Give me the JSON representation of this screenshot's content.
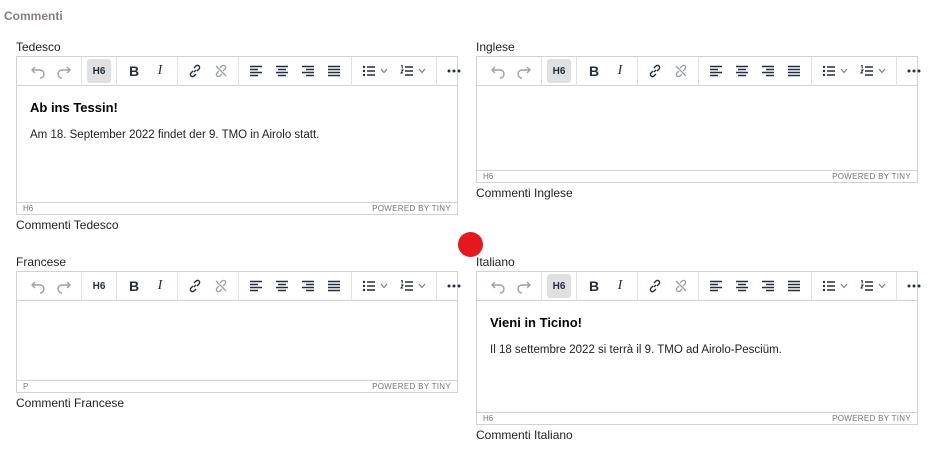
{
  "section_title": "Commenti",
  "toolbar": {
    "undo": "undo-icon",
    "redo": "redo-icon",
    "block_format": "H6",
    "bold": "B",
    "italic": "I"
  },
  "editors": {
    "de": {
      "label": "Tedesco",
      "heading": "Ab ins Tessin!",
      "paragraph": "Am 18. September 2022 findet der 9. TMO in Airolo statt.",
      "status_path": "H6",
      "brand": "POWERED BY TINY",
      "caption": "Commenti Tedesco"
    },
    "en": {
      "label": "Inglese",
      "heading": "",
      "paragraph": "",
      "status_path": "H6",
      "brand": "POWERED BY TINY",
      "caption": "Commenti Inglese"
    },
    "fr": {
      "label": "Francese",
      "heading": "",
      "paragraph": "",
      "status_path": "P",
      "brand": "POWERED BY TINY",
      "caption": "Commenti Francese"
    },
    "it": {
      "label": "Italiano",
      "heading": "Vieni in Ticino!",
      "paragraph": "Il 18 settembre 2022 si terrà il 9. TMO ad Airolo-Pesciüm.",
      "status_path": "H6",
      "brand": "POWERED BY TINY",
      "caption": "Commenti Italiano"
    }
  },
  "colors": {
    "section_title": "#8a7a8c",
    "border": "#cfd3d8",
    "active_button_bg": "#dee0e2",
    "cursor_dot": "#e3191e"
  }
}
